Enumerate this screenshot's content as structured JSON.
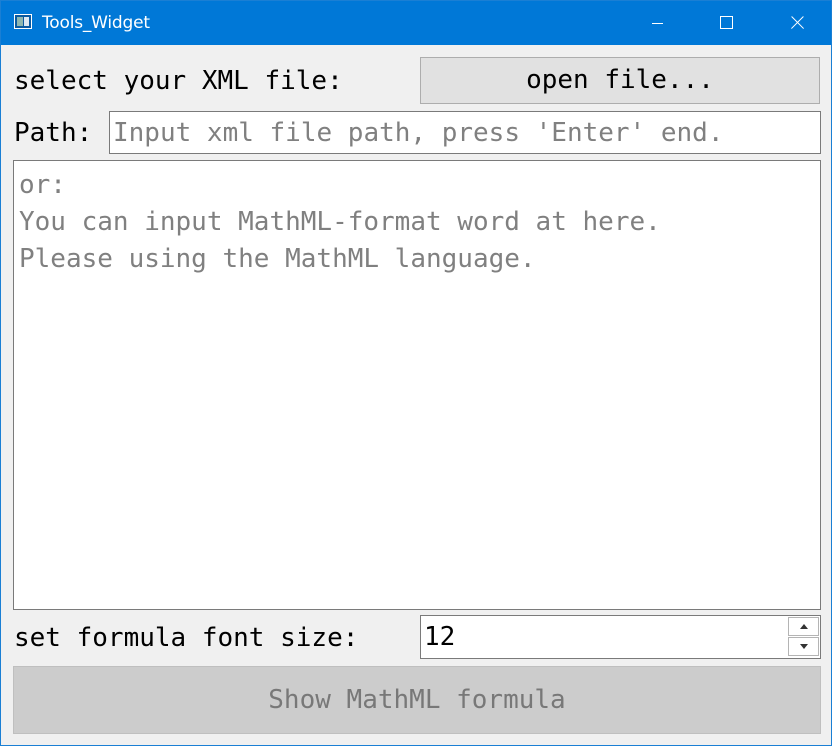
{
  "window": {
    "title": "Tools_Widget",
    "controls": [
      "minimize-icon",
      "maximize-icon",
      "close-icon"
    ]
  },
  "file_row": {
    "label": "select your XML file:",
    "button_label": "open file..."
  },
  "path_row": {
    "label": "Path:",
    "value": "",
    "placeholder": "Input xml file path, press 'Enter' end."
  },
  "mathml_input": {
    "value": "",
    "placeholder_lines": [
      "or:",
      "You can input MathML-format word at here.",
      "Please using the MathML language."
    ]
  },
  "font_size_row": {
    "label": "set formula font size:",
    "value": "12"
  },
  "show_button": {
    "label": "Show MathML formula",
    "enabled": false
  },
  "colors": {
    "titlebar": "#0078d7",
    "window_bg": "#f0f0f0",
    "disabled_button_bg": "#cccccc",
    "placeholder_text": "#808080"
  }
}
